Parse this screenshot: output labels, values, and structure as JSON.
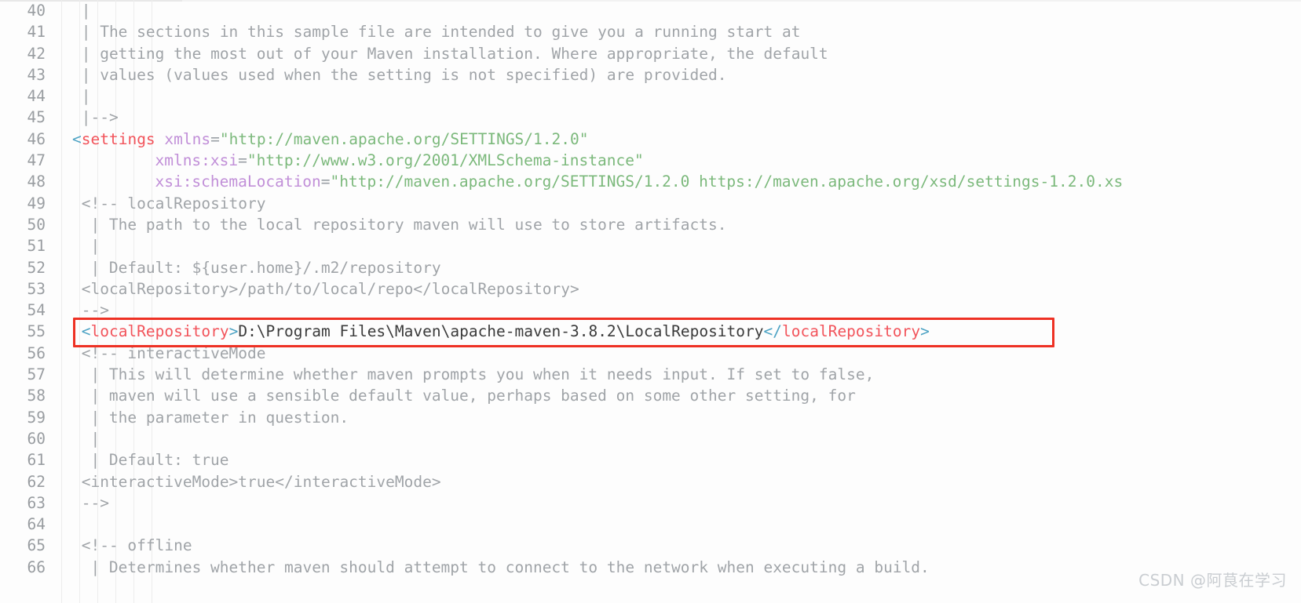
{
  "editor": {
    "language": "xml",
    "file_kind": "maven-settings",
    "first_visible_line": 40,
    "last_visible_line": 66,
    "colors": {
      "background": "#fdfdfd",
      "gutter_text": "#999da1",
      "comment": "#a0a4a8",
      "tag": "#f2545b",
      "bracket": "#4da3c4",
      "attribute": "#c18fd8",
      "string": "#7cb97c",
      "plain_text": "#3b3b3b",
      "annotation_box": "#ee3124",
      "indent_guide": "#ededed",
      "watermark": "#c9cdd1"
    }
  },
  "annotation": {
    "type": "red-rectangle-highlight",
    "target_line": 55,
    "target_text": "<localRepository>D:\\Program Files\\Maven\\apache-maven-3.8.2\\LocalRepository</localRepository>"
  },
  "watermark": {
    "text": "CSDN @阿茛在学习"
  },
  "lines": [
    {
      "n": "40",
      "tokens": [
        {
          "t": "|",
          "c": "c-comment"
        }
      ]
    },
    {
      "n": "41",
      "tokens": [
        {
          "t": "| The sections in this sample file are intended to give you a running start at",
          "c": "c-comment"
        }
      ]
    },
    {
      "n": "42",
      "tokens": [
        {
          "t": "| getting the most out of your Maven installation. Where appropriate, the default",
          "c": "c-comment"
        }
      ]
    },
    {
      "n": "43",
      "tokens": [
        {
          "t": "| values (values used when the setting is not specified) are provided.",
          "c": "c-comment"
        }
      ]
    },
    {
      "n": "44",
      "tokens": [
        {
          "t": "|",
          "c": "c-comment"
        }
      ]
    },
    {
      "n": "45",
      "tokens": [
        {
          "t": "|-->",
          "c": "c-comment"
        }
      ]
    },
    {
      "n": "46",
      "indent": 0,
      "tokens": [
        {
          "t": "<",
          "c": "c-bracket"
        },
        {
          "t": "settings",
          "c": "c-tag"
        },
        {
          "t": " ",
          "c": "c-plain"
        },
        {
          "t": "xmlns",
          "c": "c-attr"
        },
        {
          "t": "=",
          "c": "c-eq"
        },
        {
          "t": "\"http://maven.apache.org/SETTINGS/1.2.0\"",
          "c": "c-string"
        }
      ]
    },
    {
      "n": "47",
      "indent": 9,
      "tokens": [
        {
          "t": "xmlns:xsi",
          "c": "c-attr"
        },
        {
          "t": "=",
          "c": "c-eq"
        },
        {
          "t": "\"http://www.w3.org/2001/XMLSchema-instance\"",
          "c": "c-string"
        }
      ]
    },
    {
      "n": "48",
      "indent": 9,
      "tokens": [
        {
          "t": "xsi:schemaLocation",
          "c": "c-attr"
        },
        {
          "t": "=",
          "c": "c-eq"
        },
        {
          "t": "\"http://maven.apache.org/SETTINGS/1.2.0 https://maven.apache.org/xsd/settings-1.2.0.xs",
          "c": "c-string"
        }
      ]
    },
    {
      "n": "49",
      "indent": 1,
      "tokens": [
        {
          "t": "<!-- localRepository",
          "c": "c-comment"
        }
      ]
    },
    {
      "n": "50",
      "indent": 2,
      "tokens": [
        {
          "t": "| The path to the local repository maven will use to store artifacts.",
          "c": "c-comment"
        }
      ]
    },
    {
      "n": "51",
      "indent": 2,
      "tokens": [
        {
          "t": "|",
          "c": "c-comment"
        }
      ]
    },
    {
      "n": "52",
      "indent": 2,
      "tokens": [
        {
          "t": "| Default: ${user.home}/.m2/repository",
          "c": "c-comment"
        }
      ]
    },
    {
      "n": "53",
      "indent": 1,
      "tokens": [
        {
          "t": "<localRepository>/path/to/local/repo</localRepository>",
          "c": "c-comment"
        }
      ]
    },
    {
      "n": "54",
      "indent": 1,
      "tokens": [
        {
          "t": "-->",
          "c": "c-comment"
        }
      ]
    },
    {
      "n": "55",
      "indent": 1,
      "highlighted": true,
      "tokens": [
        {
          "t": "<",
          "c": "c-bracket"
        },
        {
          "t": "localRepository",
          "c": "c-tag"
        },
        {
          "t": ">",
          "c": "c-bracket"
        },
        {
          "t": "D:\\Program Files\\Maven\\apache-maven-3.8.2\\LocalRepository",
          "c": "c-text"
        },
        {
          "t": "</",
          "c": "c-bracket"
        },
        {
          "t": "localRepository",
          "c": "c-tag"
        },
        {
          "t": ">",
          "c": "c-bracket"
        }
      ]
    },
    {
      "n": "56",
      "indent": 1,
      "tokens": [
        {
          "t": "<!-- interactiveMode",
          "c": "c-comment"
        }
      ]
    },
    {
      "n": "57",
      "indent": 2,
      "tokens": [
        {
          "t": "| This will determine whether maven prompts you when it needs input. If set to false,",
          "c": "c-comment"
        }
      ]
    },
    {
      "n": "58",
      "indent": 2,
      "tokens": [
        {
          "t": "| maven will use a sensible default value, perhaps based on some other setting, for",
          "c": "c-comment"
        }
      ]
    },
    {
      "n": "59",
      "indent": 2,
      "tokens": [
        {
          "t": "| the parameter in question.",
          "c": "c-comment"
        }
      ]
    },
    {
      "n": "60",
      "indent": 2,
      "tokens": [
        {
          "t": "|",
          "c": "c-comment"
        }
      ]
    },
    {
      "n": "61",
      "indent": 2,
      "tokens": [
        {
          "t": "| Default: true",
          "c": "c-comment"
        }
      ]
    },
    {
      "n": "62",
      "indent": 1,
      "tokens": [
        {
          "t": "<interactiveMode>true</interactiveMode>",
          "c": "c-comment"
        }
      ]
    },
    {
      "n": "63",
      "indent": 1,
      "tokens": [
        {
          "t": "-->",
          "c": "c-comment"
        }
      ]
    },
    {
      "n": "64",
      "indent": 0,
      "tokens": [
        {
          "t": "",
          "c": "c-comment"
        }
      ]
    },
    {
      "n": "65",
      "indent": 1,
      "tokens": [
        {
          "t": "<!-- offline",
          "c": "c-comment"
        }
      ]
    },
    {
      "n": "66",
      "indent": 2,
      "tokens": [
        {
          "t": "| Determines whether maven should attempt to connect to the network when executing a build.",
          "c": "c-comment"
        }
      ]
    }
  ]
}
